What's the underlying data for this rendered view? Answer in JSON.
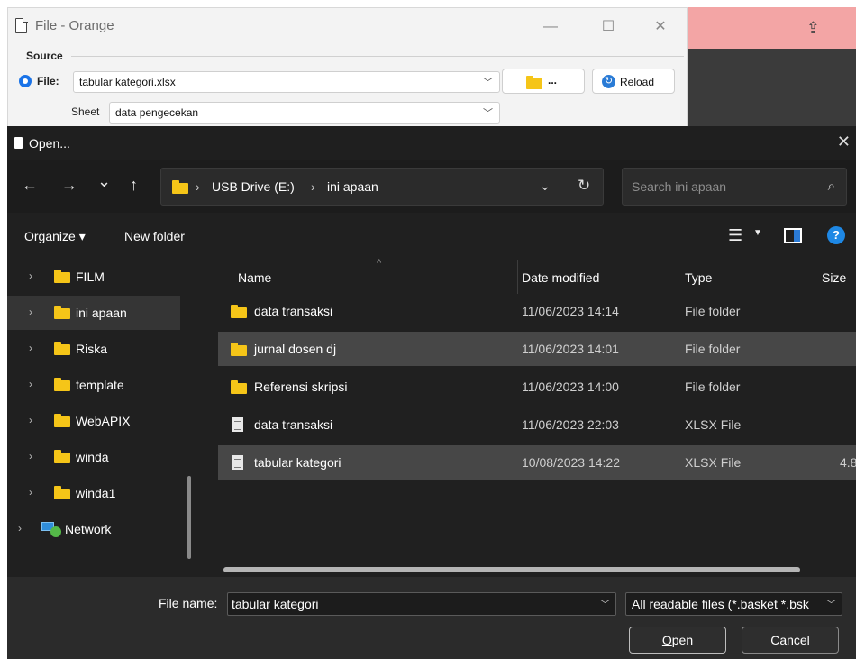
{
  "orange_window": {
    "title": "File - Orange",
    "controls": {
      "minimize": "—",
      "maximize": "☐",
      "close": "✕"
    },
    "source_label": "Source",
    "file_label": "File:",
    "file_value": "tabular kategori.xlsx",
    "sheet_label": "Sheet",
    "sheet_value": "data pengecekan",
    "browse_label": "...",
    "reload_label": "Reload"
  },
  "dialog": {
    "title": "Open...",
    "close": "✕",
    "nav": {
      "back": "←",
      "forward": "→",
      "recent": "⌄",
      "up": "↑"
    },
    "address": {
      "segments": [
        "USB Drive (E:)",
        "ini apaan"
      ],
      "separator": "›"
    },
    "search_placeholder": "Search ini apaan",
    "toolbar": {
      "organize": "Organize ▾",
      "new_folder": "New folder"
    },
    "sidebar": [
      {
        "label": "FILM",
        "selected": false
      },
      {
        "label": "ini apaan",
        "selected": true
      },
      {
        "label": "Riska",
        "selected": false
      },
      {
        "label": "template",
        "selected": false
      },
      {
        "label": "WebAPIX",
        "selected": false
      },
      {
        "label": "winda",
        "selected": false
      },
      {
        "label": "winda1",
        "selected": false
      },
      {
        "label": "Network",
        "selected": false
      }
    ],
    "columns": {
      "name": "Name",
      "date": "Date modified",
      "type": "Type",
      "size": "Size"
    },
    "files": [
      {
        "name": "data transaksi",
        "date": "11/06/2023 14:14",
        "type": "File folder",
        "size": "",
        "kind": "folder",
        "selected": false
      },
      {
        "name": "jurnal dosen dj",
        "date": "11/06/2023 14:01",
        "type": "File folder",
        "size": "",
        "kind": "folder",
        "selected": true
      },
      {
        "name": "Referensi skripsi",
        "date": "11/06/2023 14:00",
        "type": "File folder",
        "size": "",
        "kind": "folder",
        "selected": false
      },
      {
        "name": "data transaksi",
        "date": "11/06/2023 22:03",
        "type": "XLSX File",
        "size": "",
        "kind": "file",
        "selected": false
      },
      {
        "name": "tabular kategori",
        "date": "10/08/2023 14:22",
        "type": "XLSX File",
        "size": "4.8",
        "kind": "file",
        "selected": true
      }
    ],
    "filename_label_pre": "File ",
    "filename_label_u": "n",
    "filename_label_post": "ame:",
    "filename_value": "tabular kategori",
    "filetype_value": "All readable files (*.basket *.bsk",
    "open_u": "O",
    "open_rest": "pen",
    "cancel_label": "Cancel"
  },
  "colors": {
    "accent": "#1e88e5",
    "folder": "#f5c518",
    "dialog_bg": "#202020",
    "selection": "#474747"
  }
}
